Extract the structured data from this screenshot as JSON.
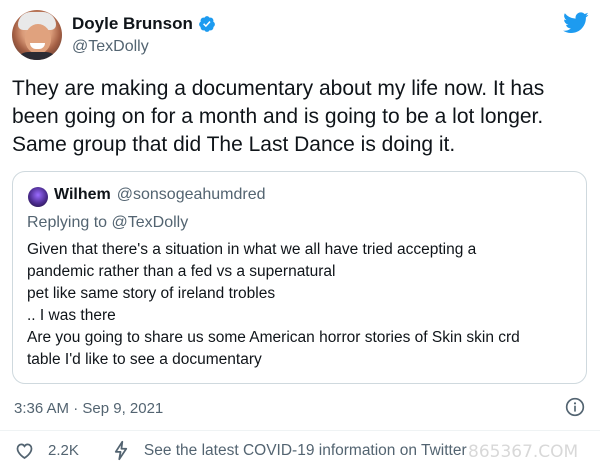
{
  "author": {
    "name": "Doyle Brunson",
    "handle": "@TexDolly",
    "verified": true
  },
  "tweet": {
    "text": "They are making a documentary about my life now. It has been going on for a month and is going to be a lot longer. Same group that did The Last Dance is doing it.",
    "timestamp": "3:36 AM · Sep 9, 2021"
  },
  "quoted_tweet": {
    "name": "Wilhem",
    "handle": "@sonsogeahumdred",
    "replying_prefix": "Replying to",
    "replying_to": "@TexDolly",
    "lines": [
      "Given that there's a situation in what we all have tried accepting a",
      "pandemic rather than a fed vs a supernatural",
      "pet like same story of ireland trobles",
      "..  I was there",
      "Are you going to share us some American horror stories of Skin skin crd",
      "table I'd like to see a documentary"
    ]
  },
  "actions": {
    "likes": "2.2K",
    "covid_label": "See the latest COVID-19 information on Twitter"
  },
  "watermark": "865367.COM",
  "icons": [
    "verified-icon",
    "twitter-logo-icon",
    "info-icon",
    "heart-icon",
    "bolt-icon"
  ],
  "colors": {
    "twitter_blue": "#1d9bf0",
    "text_primary": "#0f1419",
    "text_secondary": "#536471",
    "border": "#cfd9de"
  }
}
